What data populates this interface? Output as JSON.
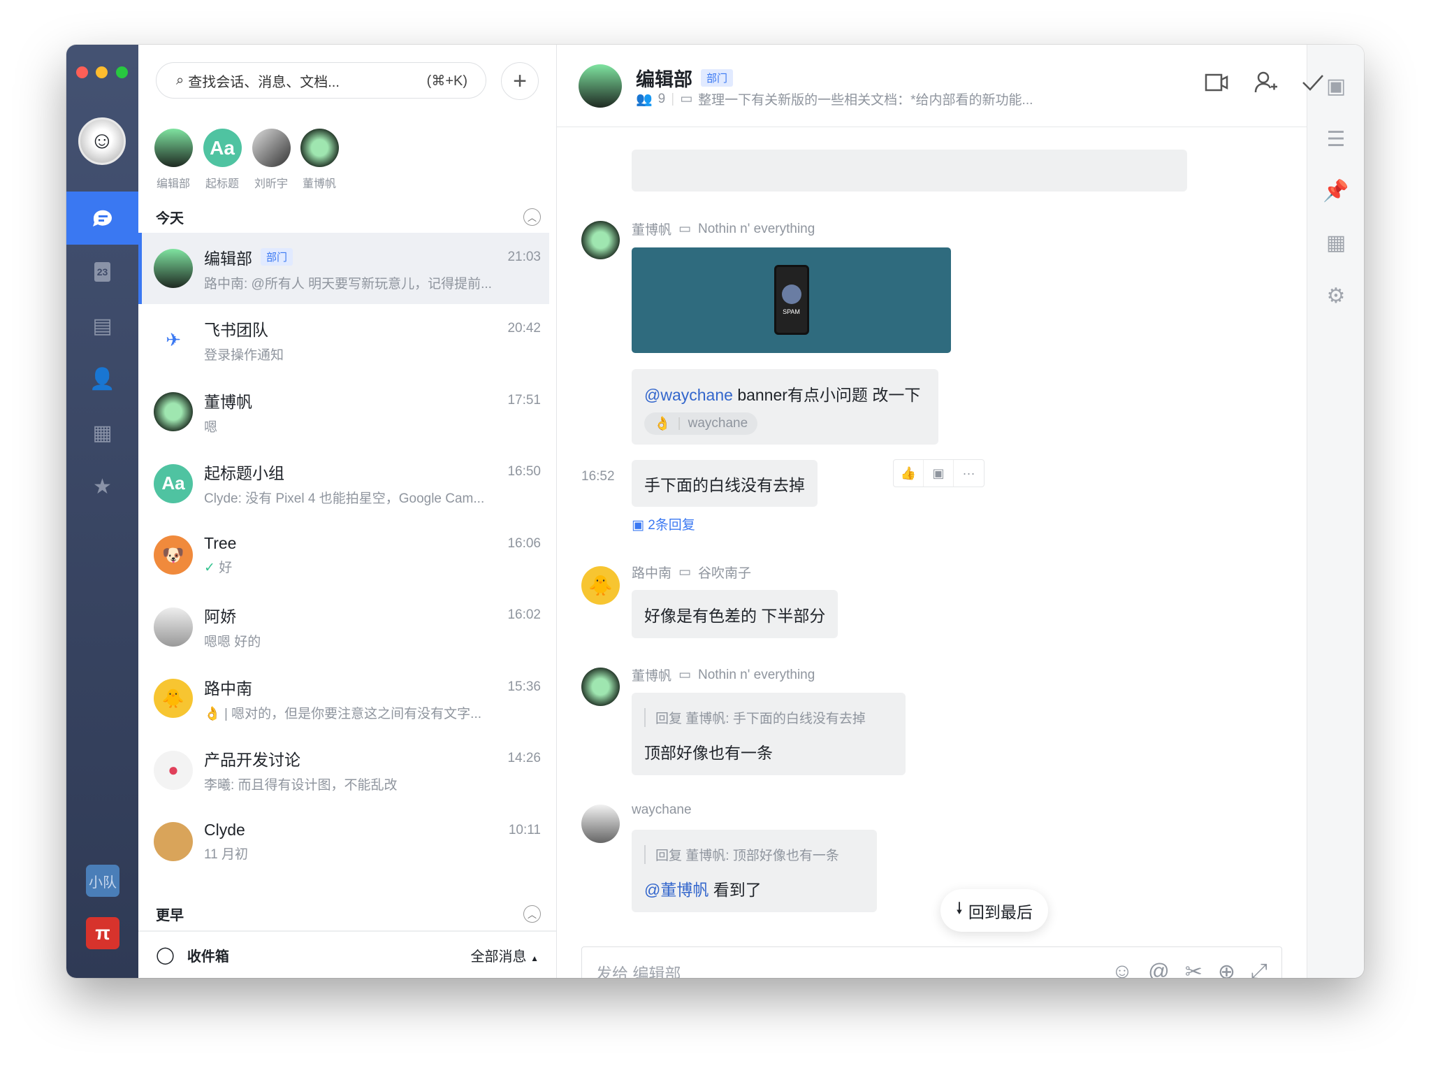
{
  "nav": {
    "items": [
      "chat-icon",
      "calendar-icon",
      "docs-icon",
      "contacts-icon",
      "apps-icon",
      "favorites-icon"
    ],
    "calendar_day": "23",
    "team_label": "小队",
    "app_label": "π",
    "active_color": "#3a78f2"
  },
  "search": {
    "placeholder": "查找会话、消息、文档...",
    "shortcut": "(⌘+K)"
  },
  "pinned": [
    {
      "name": "编辑部"
    },
    {
      "name": "起标题"
    },
    {
      "name": "刘昕宇"
    },
    {
      "name": "董博帆"
    }
  ],
  "sections": {
    "today": "今天",
    "earlier": "更早"
  },
  "chats": [
    {
      "name": "编辑部",
      "tag": "部门",
      "time": "21:03",
      "preview": "路中南: @所有人 明天要写新玩意儿，记得提前..."
    },
    {
      "name": "飞书团队",
      "time": "20:42",
      "preview": "登录操作通知"
    },
    {
      "name": "董博帆",
      "time": "17:51",
      "preview": "嗯"
    },
    {
      "name": "起标题小组",
      "time": "16:50",
      "preview": "Clyde: 没有 Pixel 4 也能拍星空，Google Cam..."
    },
    {
      "name": "Tree",
      "time": "16:06",
      "preview": "好"
    },
    {
      "name": "阿娇",
      "time": "16:02",
      "preview": "嗯嗯 好的"
    },
    {
      "name": "路中南",
      "time": "15:36",
      "preview": "嗯对的，但是你要注意这之间有没有文字..."
    },
    {
      "name": "产品开发讨论",
      "time": "14:26",
      "preview": "李曦: 而且得有设计图，不能乱改"
    },
    {
      "name": "Clyde",
      "time": "10:11",
      "preview": "11 月初"
    }
  ],
  "footer": {
    "inbox": "收件箱",
    "filter": "全部消息"
  },
  "header": {
    "title": "编辑部",
    "tag": "部门",
    "members": "9",
    "announcement": "整理一下有关新版的一些相关文档：*给内部看的新功能..."
  },
  "messages": {
    "m1": {
      "sender": "董博帆",
      "status": "Nothin n' everything",
      "image_label": "SPAM"
    },
    "m2": {
      "mention": "@waychane",
      "text": "banner有点小问题 改一下",
      "reaction_user": "waychane"
    },
    "m3": {
      "time": "16:52",
      "text": "手下面的白线没有去掉",
      "replies": "2条回复"
    },
    "m4": {
      "sender": "路中南",
      "status": "谷吹南子",
      "text": "好像是有色差的 下半部分"
    },
    "m5": {
      "sender": "董博帆",
      "status": "Nothin n' everything",
      "quote": "回复 董博帆: 手下面的白线没有去掉",
      "text": "顶部好像也有一条"
    },
    "m6": {
      "sender": "waychane",
      "quote": "回复 董博帆: 顶部好像也有一条",
      "mention": "@董博帆",
      "text": "看到了"
    }
  },
  "jump_label": "回到最后",
  "composer": {
    "placeholder": "发给 编辑部"
  }
}
